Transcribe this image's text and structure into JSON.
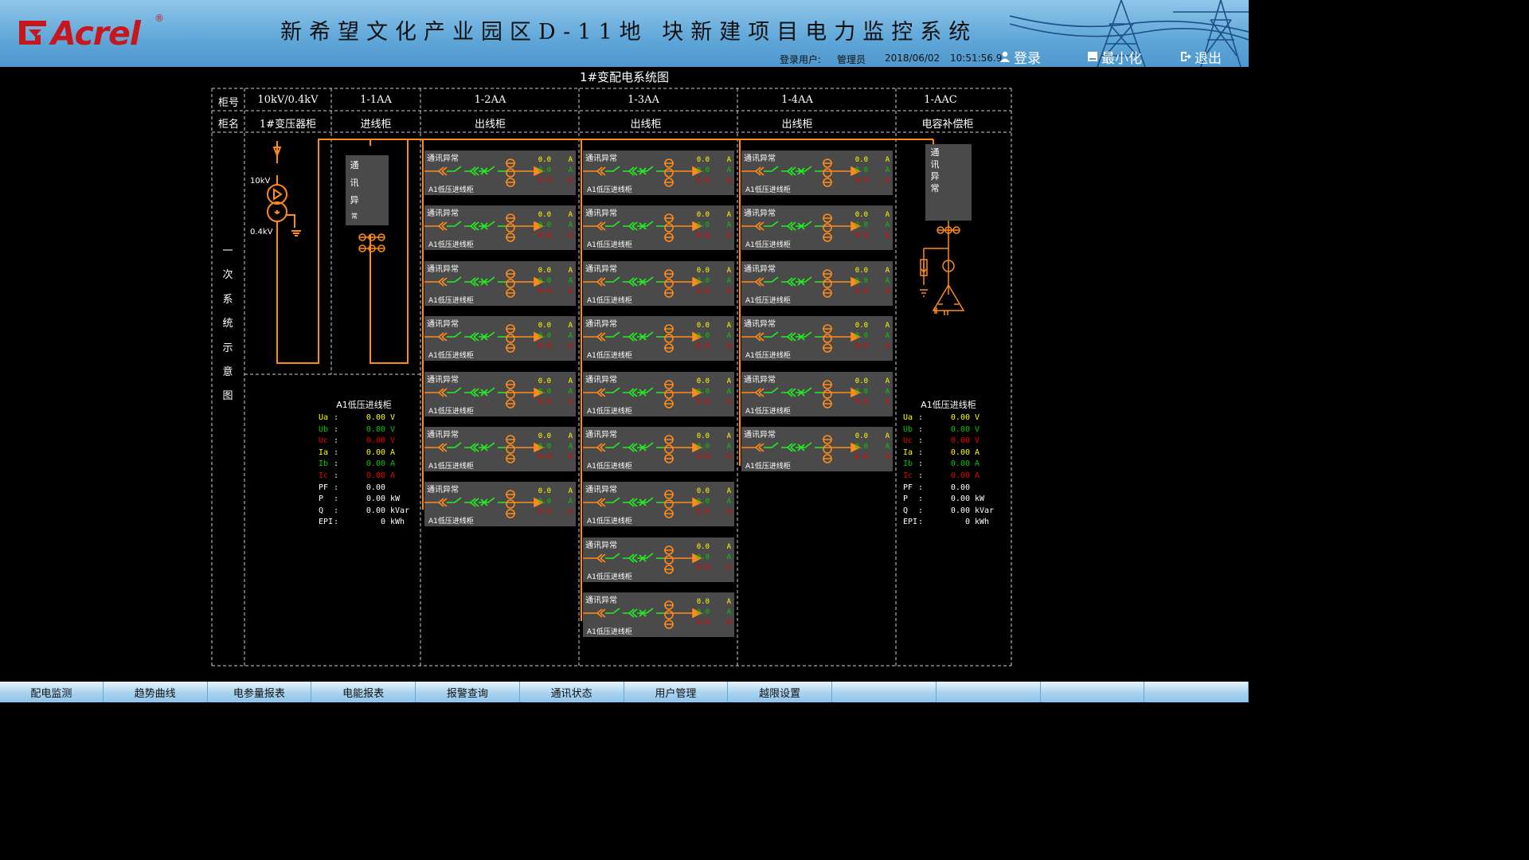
{
  "header": {
    "logo_text": "Acrel",
    "logo_reg": "®",
    "title": "新希望文化产业园区D-11地 块新建项目电力监控系统",
    "login_user_label": "登录用户:",
    "user": "管理员",
    "date": "2018/06/02",
    "time": "10:51:56.9",
    "login_btn": "登录",
    "minimize_btn": "最小化",
    "exit_btn": "退出"
  },
  "diagram_title": "1#变配电系统图",
  "table": {
    "row1_label": "柜号",
    "row2_label": "柜名",
    "columns": [
      {
        "no": "10kV/0.4kV",
        "name": "1#变压器柜"
      },
      {
        "no": "1-1AA",
        "name": "进线柜"
      },
      {
        "no": "1-2AA",
        "name": "出线柜"
      },
      {
        "no": "1-3AA",
        "name": "出线柜"
      },
      {
        "no": "1-4AA",
        "name": "出线柜"
      },
      {
        "no": "1-AAC",
        "name": "电容补偿柜"
      }
    ],
    "side_label": [
      "一",
      "次",
      "系",
      "统",
      "示",
      "意",
      "图"
    ]
  },
  "transformer": {
    "hv": "10kV",
    "lv": "0.4kV"
  },
  "comm_box_text": [
    "通",
    "讯",
    "异",
    "常"
  ],
  "feeder": {
    "status": "通讯异常",
    "name": "A1低压进线柜",
    "v1": "0.0",
    "v2": "0.0",
    "v3": "0.0",
    "unit": "A",
    "counts": [
      7,
      9,
      6
    ]
  },
  "meters": [
    {
      "title": "A1低压进线柜",
      "rows": [
        {
          "k": "Ua",
          "v": "0.00",
          "u": "V",
          "c": "#ffff00"
        },
        {
          "k": "Ub",
          "v": "0.00",
          "u": "V",
          "c": "#00cc00"
        },
        {
          "k": "Uc",
          "v": "0.00",
          "u": "V",
          "c": "#ee0000"
        },
        {
          "k": "Ia",
          "v": "0.00",
          "u": "A",
          "c": "#ffff00"
        },
        {
          "k": "Ib",
          "v": "0.00",
          "u": "A",
          "c": "#00cc00"
        },
        {
          "k": "Ic",
          "v": "0.00",
          "u": "A",
          "c": "#ee0000"
        },
        {
          "k": "PF",
          "v": "0.00",
          "u": "",
          "c": "#ffffff"
        },
        {
          "k": "P",
          "v": "0.00",
          "u": "kW",
          "c": "#ffffff"
        },
        {
          "k": "Q",
          "v": "0.00",
          "u": "kVar",
          "c": "#ffffff"
        },
        {
          "k": "EPI",
          "v": "0",
          "u": "kWh",
          "c": "#ffffff"
        }
      ]
    },
    {
      "title": "A1低压进线柜",
      "rows": [
        {
          "k": "Ua",
          "v": "0.00",
          "u": "V",
          "c": "#ffff00"
        },
        {
          "k": "Ub",
          "v": "0.00",
          "u": "V",
          "c": "#00cc00"
        },
        {
          "k": "Uc",
          "v": "0.00",
          "u": "V",
          "c": "#ee0000"
        },
        {
          "k": "Ia",
          "v": "0.00",
          "u": "A",
          "c": "#ffff00"
        },
        {
          "k": "Ib",
          "v": "0.00",
          "u": "A",
          "c": "#00cc00"
        },
        {
          "k": "Ic",
          "v": "0.00",
          "u": "A",
          "c": "#ee0000"
        },
        {
          "k": "PF",
          "v": "0.00",
          "u": "",
          "c": "#ffffff"
        },
        {
          "k": "P",
          "v": "0.00",
          "u": "kW",
          "c": "#ffffff"
        },
        {
          "k": "Q",
          "v": "0.00",
          "u": "kVar",
          "c": "#ffffff"
        },
        {
          "k": "EPI",
          "v": "0",
          "u": "kWh",
          "c": "#ffffff"
        }
      ]
    }
  ],
  "nav": [
    "配电监测",
    "趋势曲线",
    "电参量报表",
    "电能报表",
    "报警查询",
    "通讯状态",
    "用户管理",
    "越限设置",
    "",
    "",
    "",
    ""
  ],
  "colors": {
    "bus": "#ff8a1a",
    "closed": "#22ee22",
    "panel": "#4a4a4a",
    "yellow": "#ffff00",
    "green": "#00cc00",
    "red": "#ee0000"
  }
}
